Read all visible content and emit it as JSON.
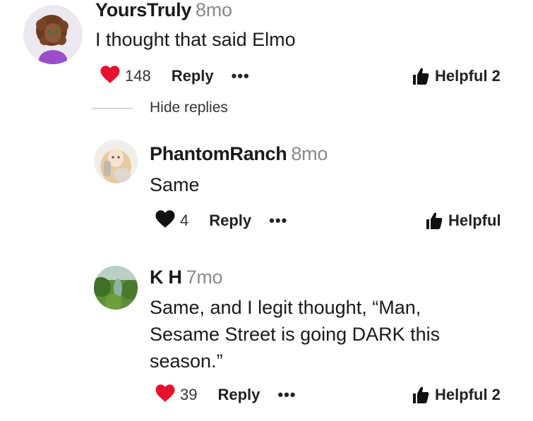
{
  "comments": [
    {
      "username": "YoursTruly",
      "time": "8mo",
      "text": "I thought that said Elmo",
      "likes": "148",
      "liked": true,
      "reply_label": "Reply",
      "more_label": "•••",
      "helpful_label": "Helpful 2"
    },
    {
      "username": "PhantomRanch",
      "time": "8mo",
      "text": "Same",
      "likes": "4",
      "liked": false,
      "reply_label": "Reply",
      "more_label": "•••",
      "helpful_label": "Helpful"
    },
    {
      "username": "K H",
      "time": "7mo",
      "text_lines": [
        "Same, and I legit thought, “Man,",
        "Sesame Street is going DARK this",
        "season.”"
      ],
      "likes": "39",
      "liked": true,
      "reply_label": "Reply",
      "more_label": "•••",
      "helpful_label": "Helpful 2"
    }
  ],
  "thread": {
    "hide_replies_label": "Hide replies"
  },
  "colors": {
    "heart_liked": "#e8112d",
    "heart_default": "#111111",
    "muted_text": "#8a8a8a"
  }
}
